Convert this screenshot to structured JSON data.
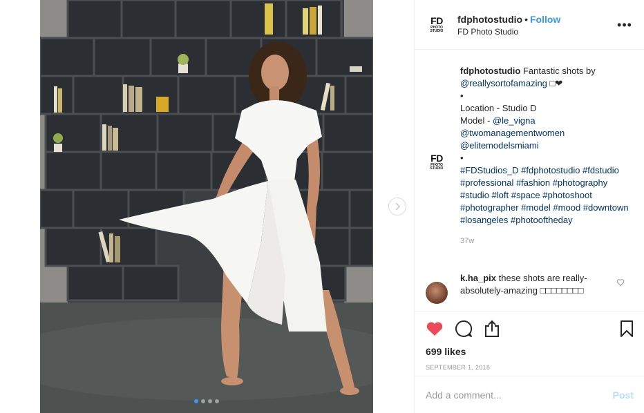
{
  "post": {
    "username": "fdphotostudio",
    "separator": "•",
    "follow_label": "Follow",
    "display_name": "FD Photo Studio",
    "logo_text": "FD",
    "logo_sub": "PHOTO STUDIO",
    "more_label": "•••",
    "carousel": {
      "count": 4,
      "active_index": 0
    }
  },
  "caption": {
    "username": "fdphotostudio",
    "line1": "Fantastic shots by",
    "mention1": "@reallysortofamazing",
    "emoji_tail": " □❤",
    "bullet": "•",
    "location": "Location - Studio D",
    "model_prefix": "Model - ",
    "mention_model": "@le_vigna",
    "mention2": "@twomanagementwomen",
    "mention3": "@elitemodelsmiami",
    "bullet2": "•",
    "hashtags": "#FDStudios_D #fdphotostudio #fdstudio #professional #fashion #photography #studio #loft #space #photoshoot #photographer #model #mood #downtown #losangeles #photooftheday",
    "age": "37w"
  },
  "comment": {
    "username": "k.ha_pix",
    "text": "these shots are really-absolutely-amazing □□□□□□□□"
  },
  "actions": {
    "likes": "699 likes",
    "date": "SEPTEMBER 1, 2018",
    "heart_color": "#ed4956"
  },
  "add_comment": {
    "placeholder": "Add a comment...",
    "post_label": "Post"
  }
}
